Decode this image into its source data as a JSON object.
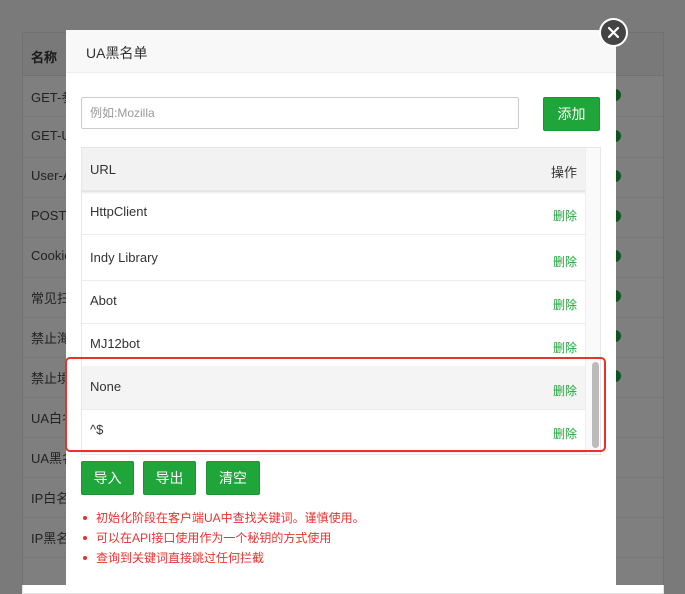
{
  "background": {
    "column_header": "名称",
    "rows": [
      "GET-参",
      "GET-U",
      "User-A",
      "POST",
      "Cookie",
      "常见扫",
      "禁止海",
      "禁止境",
      "UA白名",
      "UA黑名",
      "IP白名",
      "IP黑名"
    ]
  },
  "modal": {
    "title": "UA黑名单",
    "input_placeholder": "例如:Mozilla",
    "add_label": "添加",
    "table": {
      "headers": {
        "url": "URL",
        "action": "操作"
      },
      "rows": [
        {
          "url": "HttpClient",
          "action": "删除"
        },
        {
          "url": "Indy Library",
          "action": "删除"
        },
        {
          "url": "Abot",
          "action": "删除"
        },
        {
          "url": "MJ12bot",
          "action": "删除"
        },
        {
          "url": "None",
          "action": "删除"
        },
        {
          "url": "^$",
          "action": "删除"
        }
      ]
    },
    "buttons": {
      "import": "导入",
      "export": "导出",
      "clear": "清空"
    },
    "notes": [
      "初始化阶段在客户端UA中查找关键词。谨慎使用。",
      "可以在API接口使用作为一个秘钥的方式使用",
      "查询到关键词直接跳过任何拦截"
    ]
  },
  "colors": {
    "accent": "#20a53a",
    "warning": "#e8322f"
  },
  "icons": {
    "close": "close-icon"
  }
}
